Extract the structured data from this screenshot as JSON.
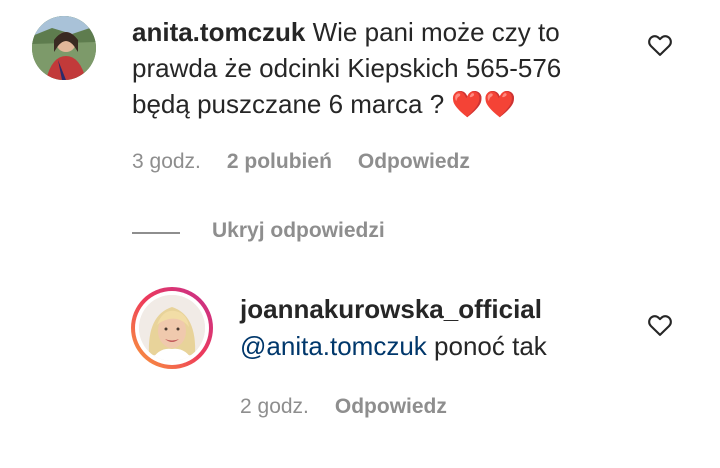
{
  "comment": {
    "username": "anita.tomczuk",
    "text": "Wie pani może czy to prawda że odcinki Kiepskich 565-576 będą puszczane 6 marca ? ❤️❤️",
    "time": "3 godz.",
    "likes": "2 polubień",
    "reply_label": "Odpowiedz",
    "avatar_icon": "profile-photo-outdoor",
    "like_icon": "heart-outline-icon"
  },
  "hide_replies_label": "Ukryj odpowiedzi",
  "reply": {
    "username": "joannakurowska_official",
    "mention": "@anita.tomczuk",
    "text": "ponoć tak",
    "time": "2 godz.",
    "reply_label": "Odpowiedz",
    "avatar_icon": "profile-photo-blonde",
    "like_icon": "heart-outline-icon"
  },
  "colors": {
    "text": "#262626",
    "secondary": "#8e8e8e",
    "mention": "#00376b",
    "story_ring_start": "#f9a23a",
    "story_ring_end": "#c22d8f"
  }
}
